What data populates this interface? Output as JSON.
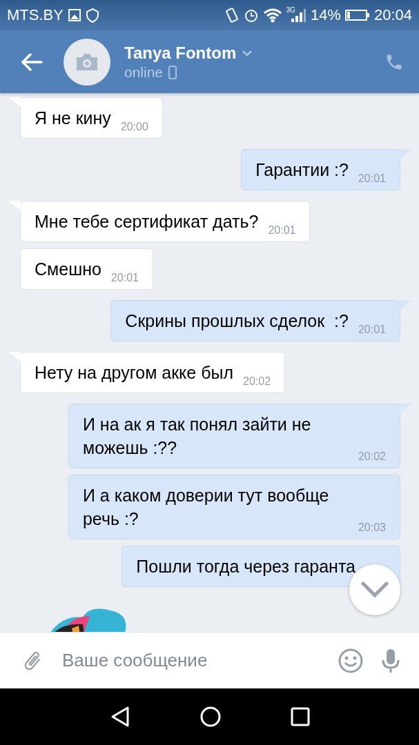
{
  "status_bar": {
    "carrier": "MTS.BY",
    "network": "3G",
    "battery": "14%",
    "time": "20:04"
  },
  "header": {
    "name": "Tanya Fontom",
    "status": "online"
  },
  "messages": [
    {
      "kind": "incoming",
      "text": "Я не кину",
      "time": "20:00"
    },
    {
      "kind": "outgoing",
      "text": "Гарантии :?",
      "time": "20:01"
    },
    {
      "kind": "incoming",
      "text": "Мне тебе сертификат дать?",
      "time": "20:01"
    },
    {
      "kind": "incoming",
      "text": "Смешно",
      "time": "20:01"
    },
    {
      "kind": "outgoing",
      "text": "Скрины прошлых сделок  :?",
      "time": "20:01"
    },
    {
      "kind": "incoming",
      "text": "Нету на другом акке был",
      "time": "20:02"
    },
    {
      "kind": "outgoing",
      "text": "И на ак я так понял зайти не можешь :??",
      "time": "20:02"
    },
    {
      "kind": "outgoing",
      "text": "И а каком доверии тут вообще речь :?",
      "time": "20:03"
    },
    {
      "kind": "outgoing",
      "text": "Пошли тогда через гаранта"
    },
    {
      "kind": "sticker"
    }
  ],
  "composer": {
    "placeholder": "Ваше сообщение"
  }
}
